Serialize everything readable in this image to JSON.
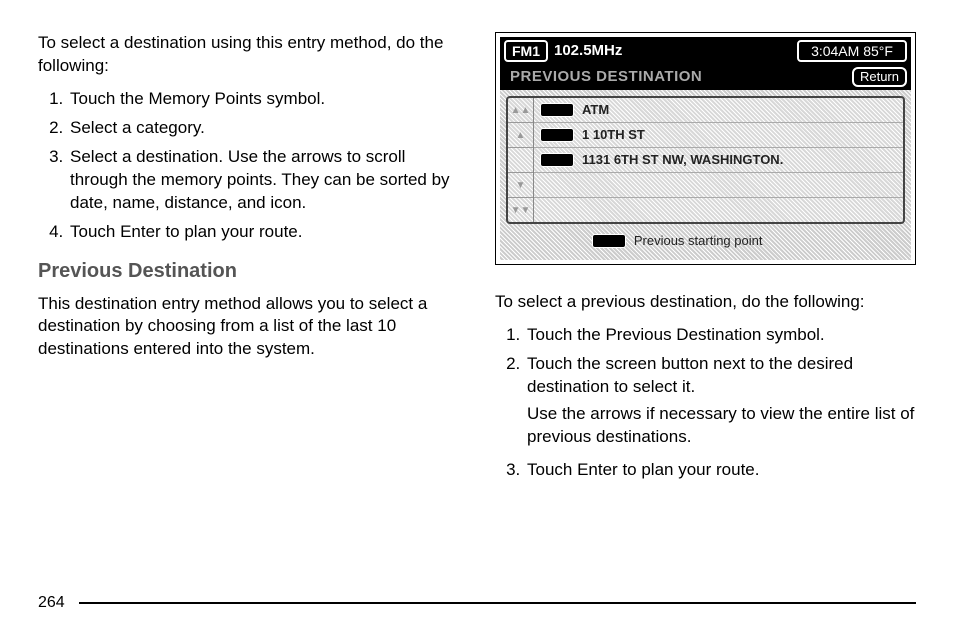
{
  "left": {
    "intro": "To select a destination using this entry method, do the following:",
    "steps": [
      "Touch the Memory Points symbol.",
      "Select a category.",
      "Select a destination. Use the arrows to scroll through the memory points. They can be sorted by date, name, distance, and icon.",
      "Touch Enter to plan your route."
    ],
    "heading": "Previous Destination",
    "desc": "This destination entry method allows you to select a destination by choosing from a list of the last 10 destinations entered into the system."
  },
  "screen": {
    "band": "FM1",
    "freq": "102.5MHz",
    "clock": "3:04AM 85°F",
    "title": "PREVIOUS DESTINATION",
    "return": "Return",
    "rows": [
      "ATM",
      "1 10TH ST",
      "1131 6TH ST NW, WASHINGTON.",
      "",
      ""
    ],
    "footer": "Previous starting point"
  },
  "right": {
    "intro": "To select a previous destination, do the following:",
    "steps": {
      "s1": "Touch the Previous Destination symbol.",
      "s2a": "Touch the screen button next to the desired destination to select it.",
      "s2b": "Use the arrows if necessary to view the entire list of previous destinations.",
      "s3": "Touch Enter to plan your route."
    }
  },
  "pageNumber": "264"
}
